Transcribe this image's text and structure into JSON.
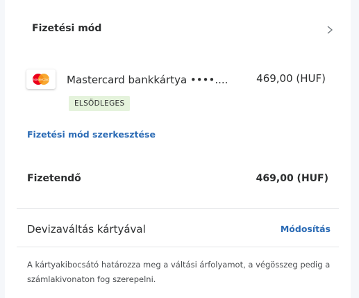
{
  "payment_section": {
    "title": "Fizetési mód"
  },
  "card": {
    "logo_text": "MasterCard",
    "name": "Mastercard bankkártya ••••....",
    "amount": "469,00 (HUF)",
    "badge": "ELSŐDLEGES"
  },
  "edit_link": "Fizetési mód szerkesztése",
  "total": {
    "label": "Fizetendő",
    "value": "469,00 (HUF)"
  },
  "conversion": {
    "label": "Devizaváltás kártyával",
    "action": "Módosítás",
    "note": "A kártyakibocsátó határozza meg a váltási árfolyamot, a végösszeg pedig a számlakivonaton fog szerepelni."
  },
  "colors": {
    "link": "#2b6bb5",
    "badge_bg": "#e5f3dc",
    "mastercard_red": "#eb001b",
    "mastercard_yellow": "#f79e1b"
  },
  "icons": {
    "chevron": "chevron-right-icon",
    "card_logo": "mastercard-logo-icon"
  }
}
